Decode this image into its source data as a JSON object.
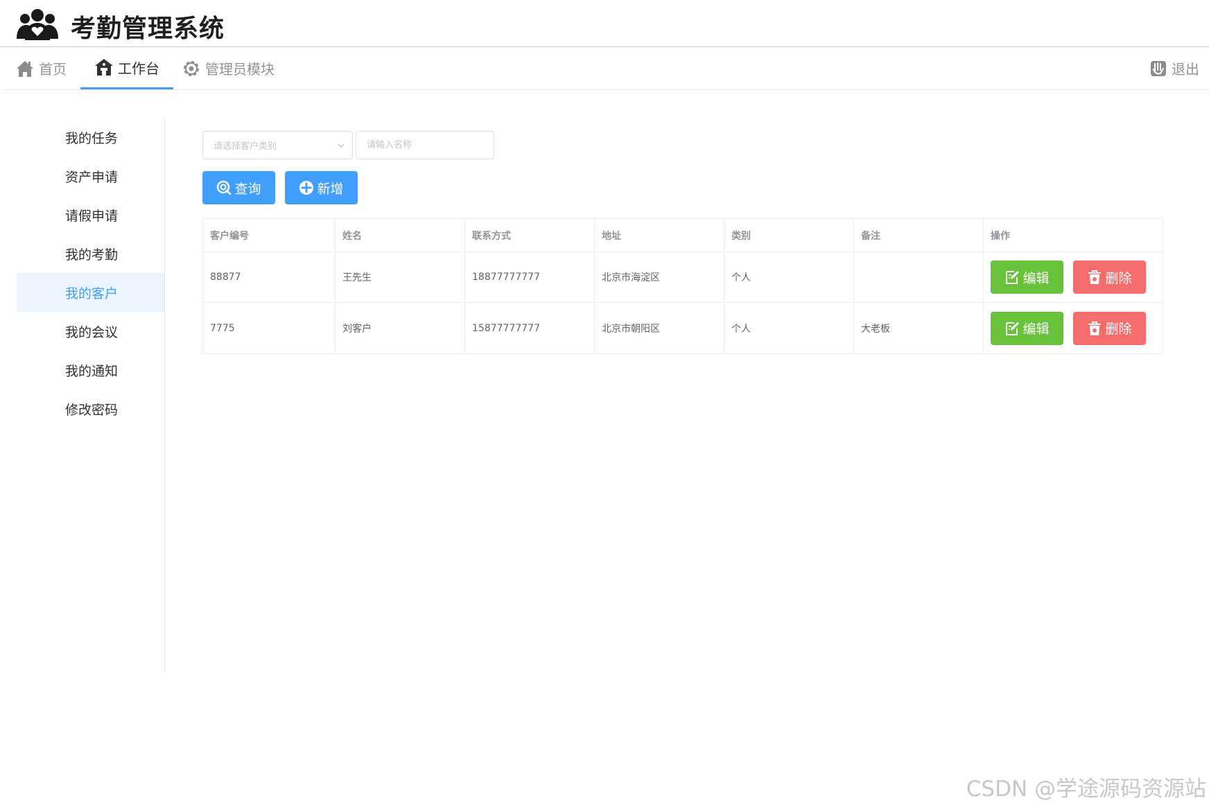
{
  "app": {
    "title": "考勤管理系统",
    "logo_icon": "users-heart-icon"
  },
  "top_nav": {
    "items": [
      {
        "label": "首页",
        "icon": "home-icon"
      },
      {
        "label": "工作台",
        "icon": "workbench-icon",
        "active": true
      },
      {
        "label": "管理员模块",
        "icon": "gear-icon"
      }
    ],
    "logout": {
      "label": "退出",
      "icon": "logout-icon"
    }
  },
  "sidebar": {
    "items": [
      {
        "label": "我的任务"
      },
      {
        "label": "资产申请"
      },
      {
        "label": "请假申请"
      },
      {
        "label": "我的考勤"
      },
      {
        "label": "我的客户",
        "active": true
      },
      {
        "label": "我的会议"
      },
      {
        "label": "我的通知"
      },
      {
        "label": "修改密码"
      }
    ]
  },
  "filters": {
    "category_placeholder": "请选择客户类别",
    "name_placeholder": "请输入名称",
    "search_label": "查询",
    "add_label": "新增"
  },
  "table": {
    "columns": [
      "客户编号",
      "姓名",
      "联系方式",
      "地址",
      "类别",
      "备注",
      "操作"
    ],
    "rows": [
      {
        "id": "88877",
        "name": "王先生",
        "phone": "18877777777",
        "address": "北京市海淀区",
        "category": "个人",
        "note": ""
      },
      {
        "id": "7775",
        "name": "刘客户",
        "phone": "15877777777",
        "address": "北京市朝阳区",
        "category": "个人",
        "note": "大老板"
      }
    ],
    "edit_label": "编辑",
    "delete_label": "删除"
  },
  "colors": {
    "primary": "#409eff",
    "success": "#67c23a",
    "danger": "#f56c6c",
    "active_bg": "#ecf5ff"
  },
  "watermark": "CSDN @学途源码资源站"
}
